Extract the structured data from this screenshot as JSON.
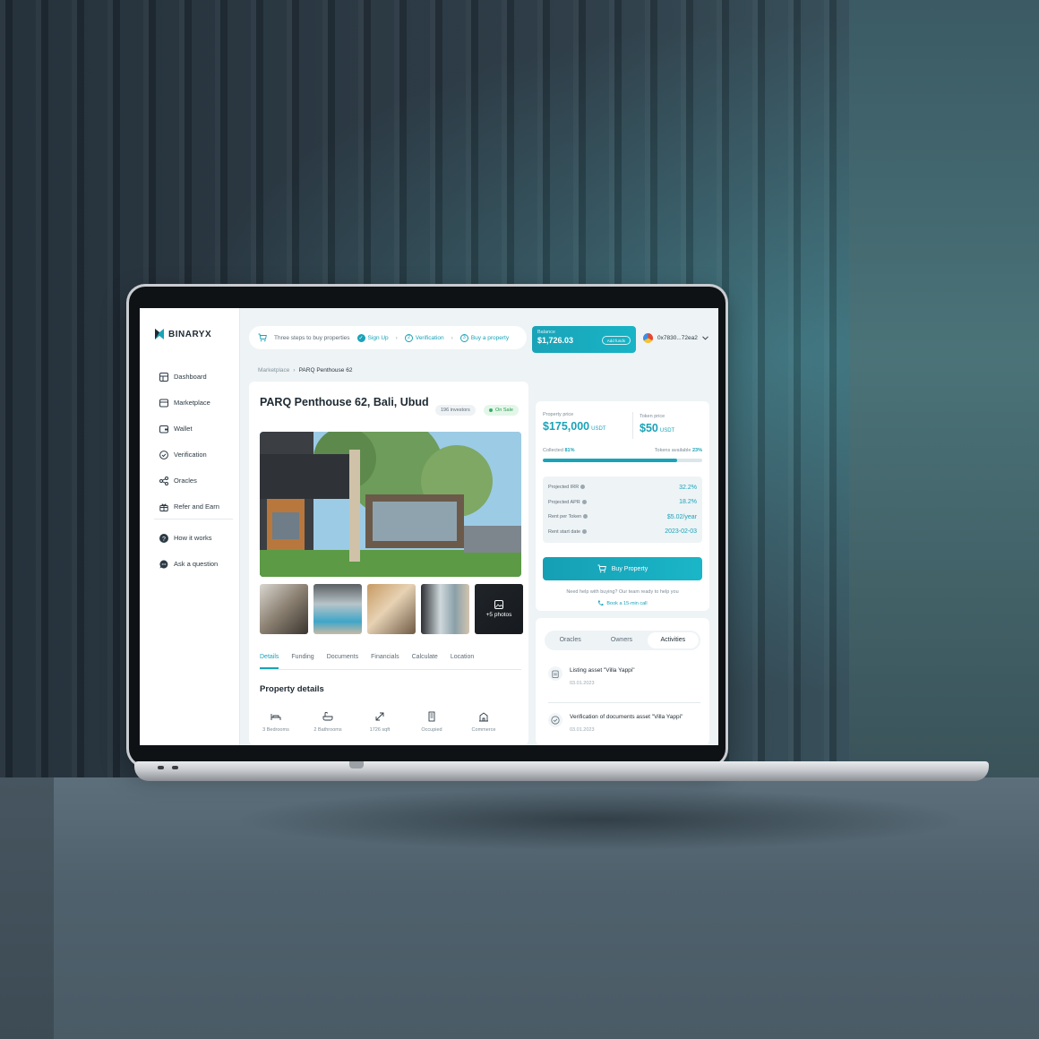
{
  "brand": {
    "name": "BINARYX"
  },
  "sidebar": {
    "items": [
      {
        "label": "Dashboard",
        "icon": "dashboard-icon"
      },
      {
        "label": "Marketplace",
        "icon": "marketplace-icon"
      },
      {
        "label": "Wallet",
        "icon": "wallet-icon"
      },
      {
        "label": "Verification",
        "icon": "verification-icon"
      },
      {
        "label": "Oracles",
        "icon": "oracles-icon"
      },
      {
        "label": "Refer and Earn",
        "icon": "gift-icon"
      }
    ],
    "secondary": [
      {
        "label": "How it works",
        "icon": "help-icon"
      },
      {
        "label": "Ask a question",
        "icon": "chat-icon"
      }
    ]
  },
  "topbar": {
    "steps_title": "Three steps to buy properties",
    "steps": [
      "Sign Up",
      "Verification",
      "Buy a property"
    ],
    "balance_label": "Balance",
    "balance_value": "$1,726.03",
    "add_funds": "Add funds",
    "wallet_address": "0x7830...72ea2"
  },
  "breadcrumb": {
    "parent": "Marketplace",
    "current": "PARQ Penthouse 62"
  },
  "property": {
    "title": "PARQ Penthouse 62, Bali, Ubud",
    "investors": "196 investors",
    "status": "On Sale",
    "more_photos": "+5 photos",
    "tabs": [
      "Details",
      "Funding",
      "Documents",
      "Financials",
      "Calculate",
      "Location"
    ],
    "details_title": "Property details",
    "features": [
      {
        "label": "3 Bedrooms",
        "icon": "bed-icon"
      },
      {
        "label": "2 Bathrooms",
        "icon": "bath-icon"
      },
      {
        "label": "1726 sqft",
        "icon": "area-icon"
      },
      {
        "label": "Occupied",
        "icon": "building-icon"
      },
      {
        "label": "Commerce",
        "icon": "commerce-icon"
      }
    ]
  },
  "pricing": {
    "property_price_label": "Property price",
    "property_price": "$175,000",
    "price_currency": "USDT",
    "token_price_label": "Token price",
    "token_price": "$50",
    "token_currency": "USDT",
    "collected_label": "Collected",
    "collected_value": "81%",
    "collected_fraction": 0.84,
    "tokens_available_label": "Tokens available",
    "tokens_available_value": "23%",
    "metrics": [
      {
        "label": "Projected IRR",
        "value": "32.2%"
      },
      {
        "label": "Projected APR",
        "value": "18.2%"
      },
      {
        "label": "Rent per Token",
        "value": "$5.02/year"
      },
      {
        "label": "Rent start date",
        "value": "2023-02-03"
      }
    ],
    "buy_label": "Buy Property",
    "help_text": "Need help with buying? Our team ready to help you",
    "help_link": "Book a 15-min call"
  },
  "activity": {
    "tabs": [
      "Oracles",
      "Owners",
      "Activities"
    ],
    "active_tab": "Activities",
    "items": [
      {
        "title": "Listing asset \"Villa Yappi\"",
        "date": "03.01.2023"
      },
      {
        "title": "Verification of documents asset \"Villa Yappi\"",
        "date": "03.01.2023"
      }
    ]
  },
  "colors": {
    "accent": "#1aa3b8",
    "success": "#2fb260"
  }
}
